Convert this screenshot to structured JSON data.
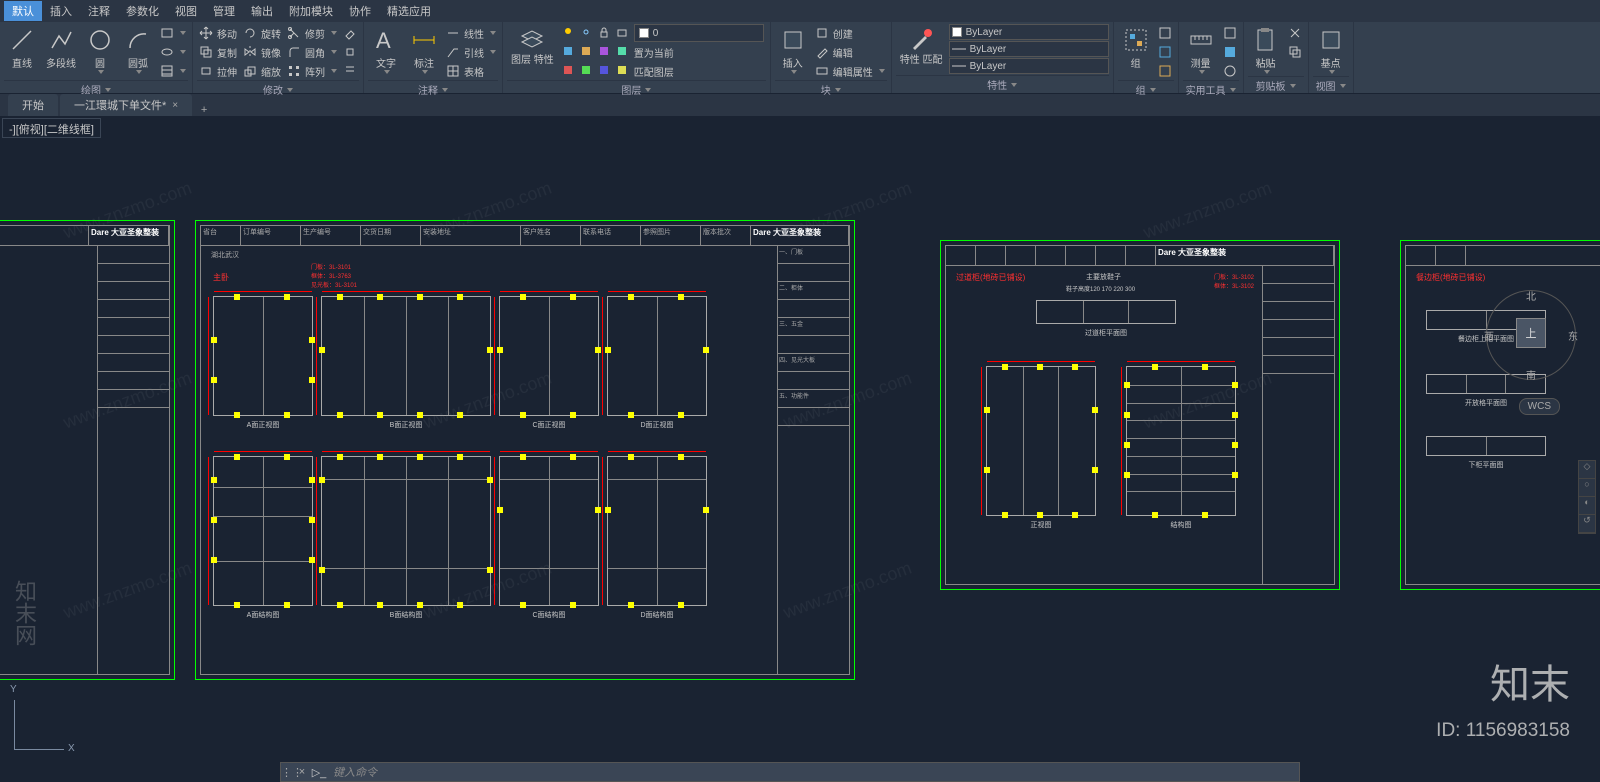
{
  "menu": {
    "items": [
      "默认",
      "插入",
      "注释",
      "参数化",
      "视图",
      "管理",
      "输出",
      "附加模块",
      "协作",
      "精选应用"
    ],
    "active_index": 0
  },
  "ribbon": {
    "draw": {
      "label": "绘图",
      "line": "直线",
      "polyline": "多段线",
      "circle": "圆",
      "arc": "圆弧"
    },
    "modify": {
      "label": "修改",
      "move": "移动",
      "rotate": "旋转",
      "trim": "修剪",
      "copy": "复制",
      "mirror": "镜像",
      "fillet": "圆角",
      "stretch": "拉伸",
      "scale": "缩放",
      "array": "阵列"
    },
    "annotate": {
      "label": "注释",
      "text": "文字",
      "dim": "标注",
      "linear": "线性",
      "leader": "引线",
      "table": "表格"
    },
    "layers": {
      "label": "图层",
      "props": "图层\n特性",
      "current": "0",
      "make_current": "置为当前",
      "match": "匹配图层"
    },
    "block": {
      "label": "块",
      "insert": "插入",
      "create": "创建",
      "edit": "编辑",
      "edit_attr": "编辑属性"
    },
    "props": {
      "label": "特性",
      "match": "特性\n匹配",
      "bylayer": "ByLayer"
    },
    "group": {
      "label": "组",
      "group": "组"
    },
    "util": {
      "label": "实用工具",
      "measure": "测量"
    },
    "clip": {
      "label": "剪贴板",
      "paste": "粘贴"
    },
    "view": {
      "label": "视图",
      "base": "基点"
    }
  },
  "tabs": {
    "start": "开始",
    "doc": "一江環城下单文件*"
  },
  "viewport_label": "-][俯视][二维线框]",
  "cmd": {
    "placeholder": "键入命令"
  },
  "navcube": {
    "top": "上",
    "n": "北",
    "s": "南",
    "e": "东",
    "w": "西",
    "wcs": "WCS"
  },
  "ucs": {
    "x": "X",
    "y": "Y"
  },
  "sheet1": {
    "brand": "Dare 大亚圣象整装"
  },
  "sheet2": {
    "header": [
      "省台",
      "订单编号",
      "生产编号",
      "交货日期",
      "安装地址",
      "客户姓名",
      "联系电话",
      "参照图片",
      "版本批次"
    ],
    "province": "湖北武汉",
    "brand": "Dare 大亚圣象整装",
    "room": "主卧",
    "spec1": "门板：3L-3101",
    "spec2": "框体：3L-3763",
    "spec3": "见光板：3L-3101",
    "row1_labels": [
      "A面正视图",
      "B面正视图",
      "C面正视图",
      "D面正视图"
    ],
    "row2_labels": [
      "A面结构图",
      "B面结构图",
      "C面结构图",
      "D面结构图"
    ],
    "side_labels": [
      "一、门板",
      "二、柜体",
      "三、五金",
      "四、见光大板",
      "五、功能件"
    ]
  },
  "sheet3": {
    "brand": "Dare 大亚圣象整装",
    "title": "过道柜(地砖已铺设)",
    "note": "主要放鞋子",
    "dims": "鞋子高度120  170 220 300",
    "plan_label": "过道柜平面图",
    "elev_label": "正视图",
    "struct_label": "结构图",
    "spec1": "门板：3L-3102",
    "spec2": "框体：3L-3102"
  },
  "sheet4": {
    "title": "餐边柜(地砖已铺设)",
    "l1": "餐边柜上柜平面图",
    "l2": "开放格平面图",
    "l3": "下柜平面图"
  },
  "watermark": {
    "text": "www.znzmo.com",
    "brand": "知末",
    "side": "知末网",
    "id": "ID: 1156983158"
  }
}
